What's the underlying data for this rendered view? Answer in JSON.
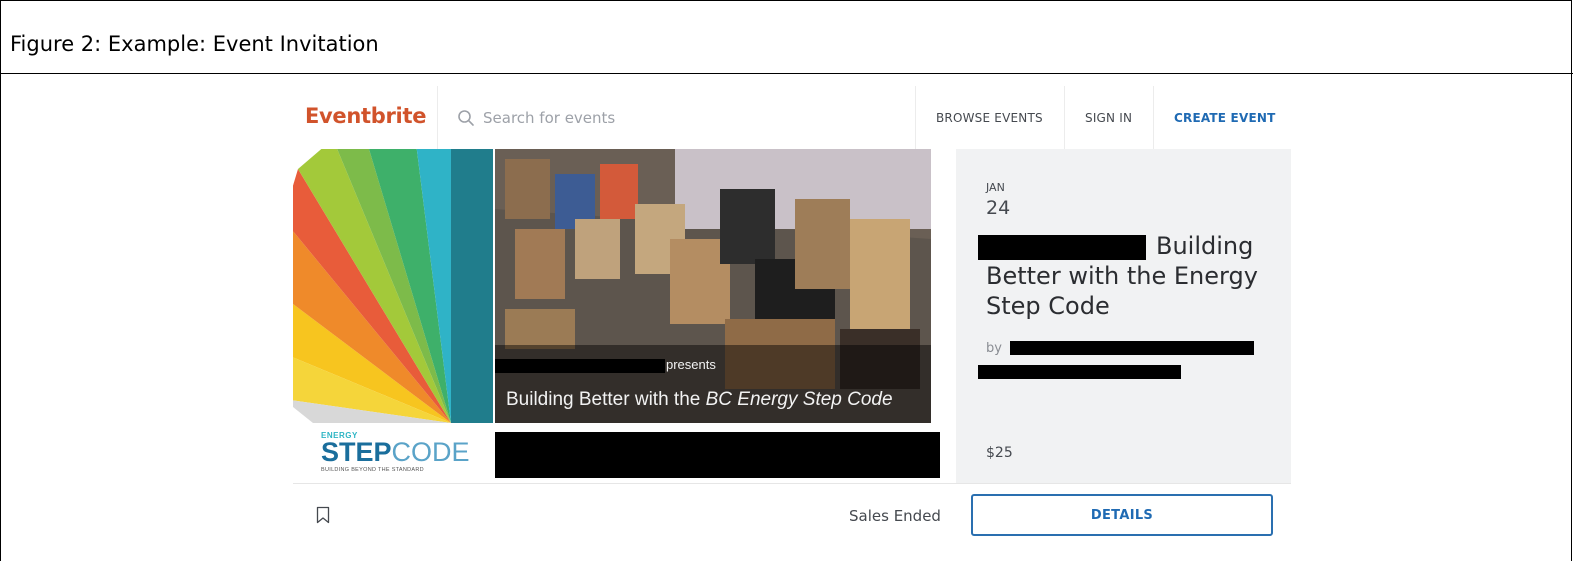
{
  "figure": {
    "caption": "Figure 2: Example: Event Invitation"
  },
  "header": {
    "logo": "Eventbrite",
    "search_placeholder": "Search for events",
    "nav": {
      "browse": "BROWSE EVENTS",
      "sign_in": "SIGN IN",
      "create": "CREATE EVENT"
    }
  },
  "banner": {
    "logo": {
      "small": "ENERGY",
      "bold": "STEP",
      "light": "CODE",
      "tagline": "BUILDING BEYOND THE STANDARD"
    },
    "photo_presents": "presents",
    "photo_title_plain": "Building Better with the ",
    "photo_title_italic": "BC Energy Step Code"
  },
  "event": {
    "month": "JAN",
    "day": "24",
    "title": "Building Better with the Energy Step Code",
    "by_prefix": "by",
    "price": "$25"
  },
  "footer": {
    "status": "Sales Ended",
    "details_label": "DETAILS"
  },
  "colors": {
    "brand": "#d1532b",
    "link": "#1f6ab3",
    "panel": "#f1f2f3"
  },
  "icons": {
    "search": "search-icon",
    "bookmark": "bookmark-icon"
  }
}
